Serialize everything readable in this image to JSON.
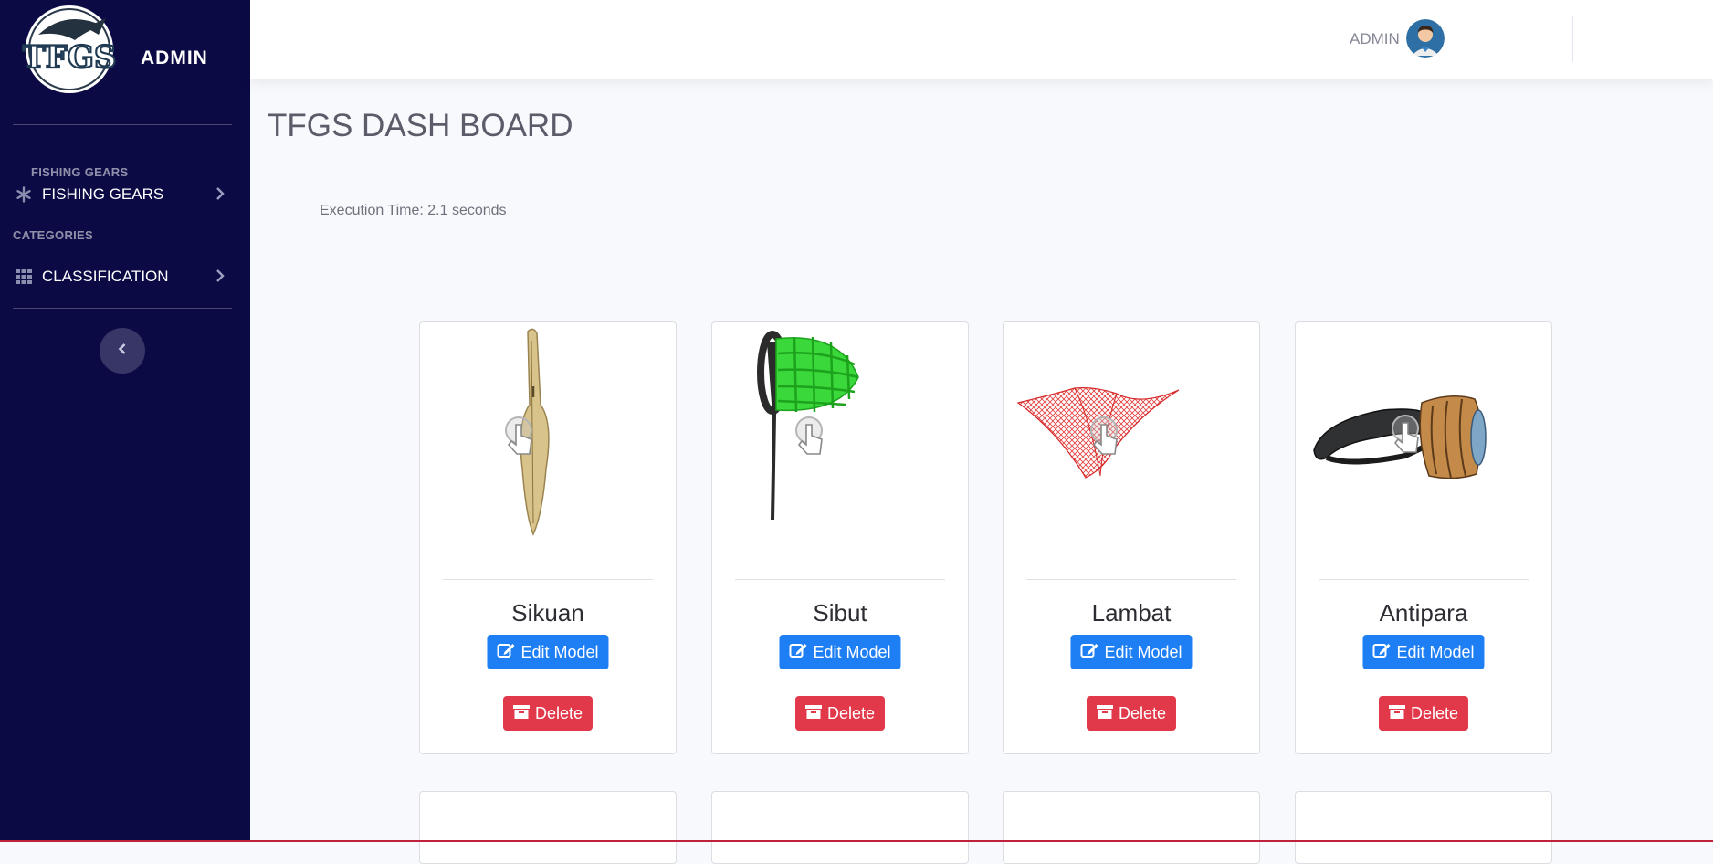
{
  "sidebar": {
    "brand_title": "ADMIN",
    "logo_text": "TFGS",
    "section_fishing": "FISHING GEARS",
    "item_fishing": "FISHING GEARS",
    "section_categories": "CATEGORIES",
    "item_classification": "CLASSIFICATION"
  },
  "topbar": {
    "user_name": "ADMIN"
  },
  "main": {
    "title": "TFGS DASH BOARD",
    "execution_time": "Execution Time: 2.1 seconds"
  },
  "cards": [
    {
      "name": "Sikuan",
      "edit_label": "Edit Model",
      "delete_label": "Delete"
    },
    {
      "name": "Sibut",
      "edit_label": "Edit Model",
      "delete_label": "Delete"
    },
    {
      "name": "Lambat",
      "edit_label": "Edit Model",
      "delete_label": "Delete"
    },
    {
      "name": "Antipara",
      "edit_label": "Edit Model",
      "delete_label": "Delete"
    }
  ],
  "colors": {
    "sidebar_bg": "#0b0a45",
    "primary": "#1e7ff5",
    "danger": "#e1384a"
  }
}
